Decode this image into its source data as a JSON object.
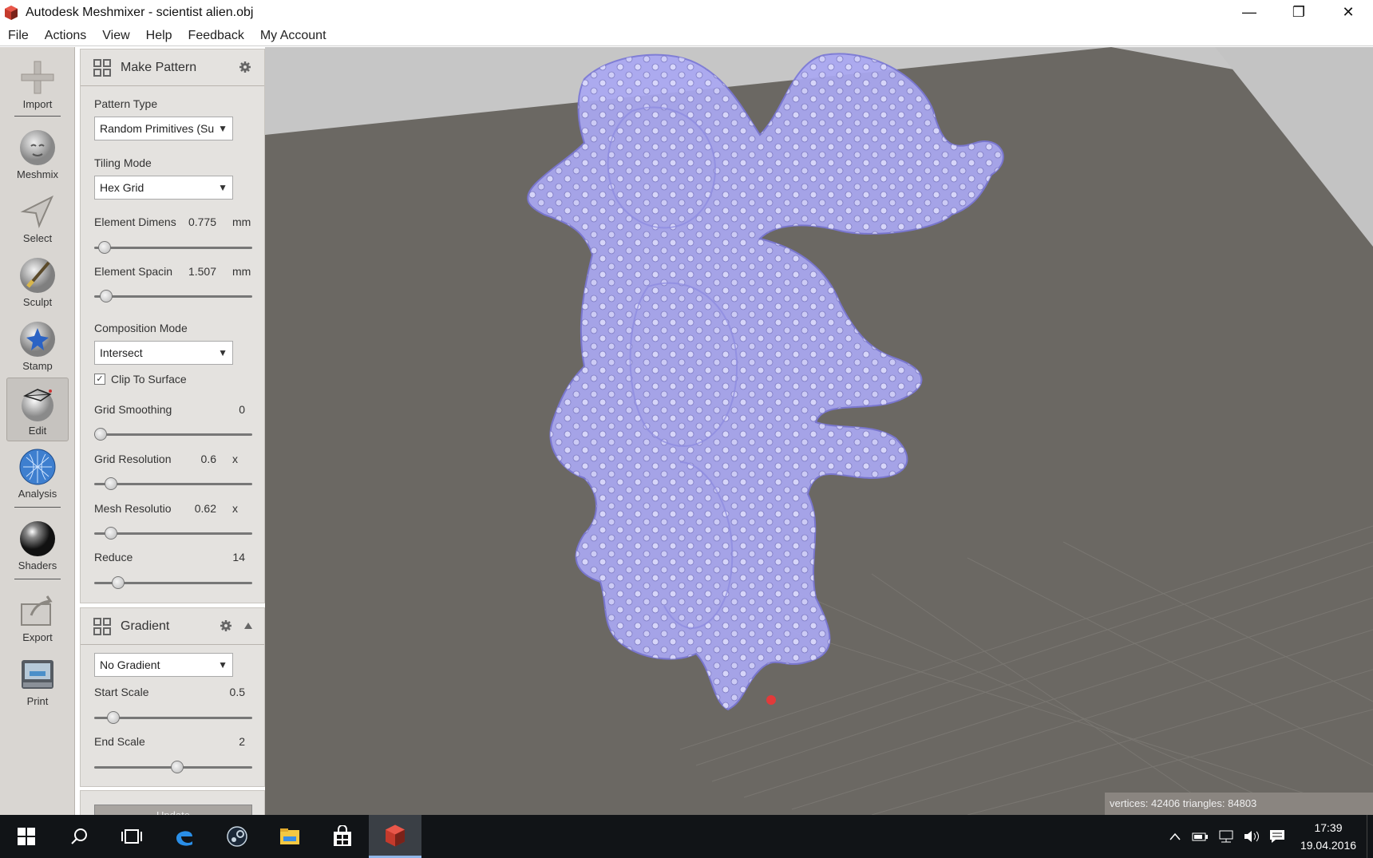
{
  "window": {
    "title": "Autodesk Meshmixer - scientist alien.obj",
    "minimize_glyph": "—",
    "maximize_glyph": "❐",
    "close_glyph": "✕"
  },
  "menu": [
    "File",
    "Actions",
    "View",
    "Help",
    "Feedback",
    "My Account"
  ],
  "toolbar": {
    "tools": [
      {
        "label": "Import",
        "icon": "plus-icon"
      },
      {
        "label": "Meshmix",
        "icon": "meshmix-icon"
      },
      {
        "label": "Select",
        "icon": "select-arrow-icon"
      },
      {
        "label": "Sculpt",
        "icon": "sculpt-brush-icon"
      },
      {
        "label": "Stamp",
        "icon": "stamp-icon"
      },
      {
        "label": "Edit",
        "icon": "edit-icon"
      },
      {
        "label": "Analysis",
        "icon": "analysis-icon"
      },
      {
        "label": "Shaders",
        "icon": "shaders-icon"
      },
      {
        "label": "Export",
        "icon": "export-icon"
      },
      {
        "label": "Print",
        "icon": "print-icon"
      }
    ],
    "active": "Edit"
  },
  "make_pattern": {
    "title": "Make Pattern",
    "pattern_type": {
      "label": "Pattern Type",
      "value": "Random Primitives (Su"
    },
    "tiling_mode": {
      "label": "Tiling Mode",
      "value": "Hex Grid"
    },
    "element_dimens": {
      "label": "Element Dimens",
      "value": "0.775",
      "unit": "mm",
      "level": 0.03
    },
    "element_spacing": {
      "label": "Element Spacin",
      "value": "1.507",
      "unit": "mm",
      "level": 0.04
    },
    "composition_mode": {
      "label": "Composition Mode",
      "value": "Intersect"
    },
    "clip_to_surface": {
      "label": "Clip To Surface",
      "checked": true,
      "check_glyph": "✓"
    },
    "grid_smoothing": {
      "label": "Grid Smoothing",
      "value": "0",
      "level": 0.0
    },
    "grid_resolution": {
      "label": "Grid Resolution",
      "value": "0.6",
      "unit": "x",
      "level": 0.07
    },
    "mesh_resolution": {
      "label": "Mesh Resolutio",
      "value": "0.62",
      "unit": "x",
      "level": 0.07
    },
    "reduce": {
      "label": "Reduce",
      "value": "14",
      "level": 0.12
    }
  },
  "gradient": {
    "title": "Gradient",
    "mode": {
      "value": "No Gradient"
    },
    "start_scale": {
      "label": "Start Scale",
      "value": "0.5",
      "level": 0.09
    },
    "end_scale": {
      "label": "End Scale",
      "value": "2",
      "level": 0.53
    },
    "update_label": "Update"
  },
  "viewport": {
    "stats": "vertices: 42406 triangles: 84803",
    "mesh_color": "#a7a5f0",
    "floor_color": "#6b6863",
    "bg_color": "#c8c8c8"
  },
  "taskbar": {
    "items": [
      "windows-start-icon",
      "search-icon",
      "task-view-icon",
      "edge-icon",
      "steam-icon",
      "file-explorer-icon",
      "store-icon",
      "meshmixer-icon"
    ],
    "time": "17:39",
    "date": "19.04.2016"
  }
}
